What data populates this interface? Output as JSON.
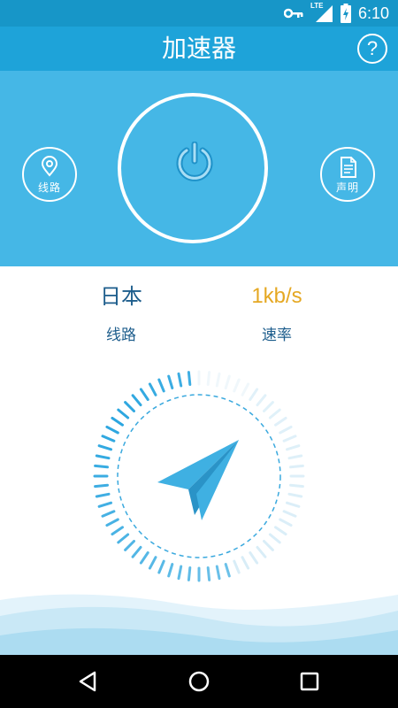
{
  "status_bar": {
    "time": "6:10",
    "network": "LTE"
  },
  "app_bar": {
    "title": "加速器"
  },
  "hero": {
    "route_button": "线路",
    "statement_button": "声明"
  },
  "info": {
    "route_value": "日本",
    "route_label": "线路",
    "speed_value": "1kb/s",
    "speed_label": "速率"
  },
  "colors": {
    "status_bar": "#1796c8",
    "app_bar": "#1ea3d9",
    "hero": "#45b7e6",
    "accent_blue": "#1d5d8c",
    "speed_orange": "#e5a823"
  },
  "icons": [
    "key-icon",
    "signal-icon",
    "battery-icon",
    "help-icon",
    "power-icon",
    "location-pin-icon",
    "document-icon",
    "paper-plane-icon",
    "back-icon",
    "home-icon",
    "recents-icon"
  ]
}
